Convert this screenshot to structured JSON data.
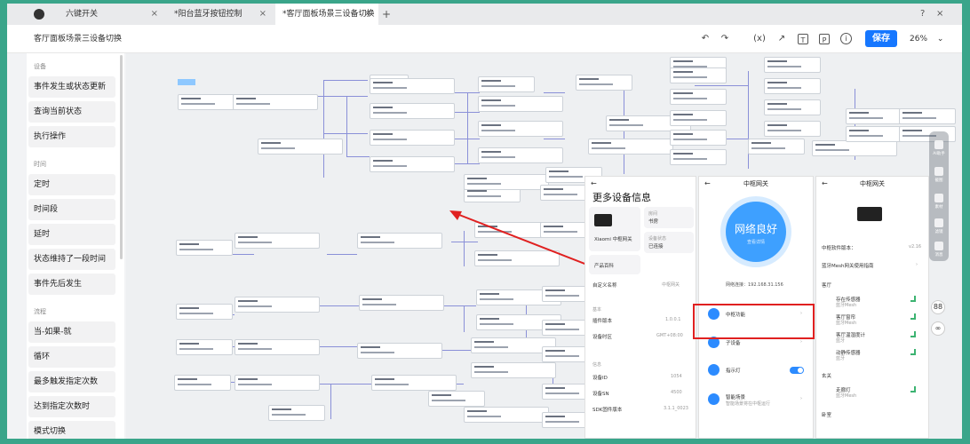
{
  "tabs": [
    {
      "label": "六键开关",
      "close": "×"
    },
    {
      "label": "*阳台蓝牙按钮控制",
      "close": "×"
    },
    {
      "label": "*客厅面板场景三设备切换",
      "close": "×"
    }
  ],
  "tab_plus": "+",
  "window_controls": {
    "help": "?",
    "close": "×"
  },
  "toolbar": {
    "doc_title": "客厅面板场景三设备切换",
    "undo": "↶",
    "redo": "↷",
    "variable": "(x)",
    "export": "↗",
    "text": "T",
    "p": "P",
    "info": "i",
    "save_label": "保存",
    "zoom": "26%",
    "zoom_caret": "⌄"
  },
  "sidebar": {
    "sections": [
      {
        "title": "设备",
        "items": [
          "事件发生或状态更新",
          "查询当前状态",
          "执行操作"
        ]
      },
      {
        "title": "时间",
        "items": [
          "定时",
          "时间段",
          "延时",
          "状态维持了一段时间",
          "事件先后发生"
        ]
      },
      {
        "title": "流程",
        "items": [
          "当-如果-就",
          "循环",
          "最多触发指定次数",
          "达到指定次数时",
          "模式切换"
        ]
      }
    ]
  },
  "panel1": {
    "back": "←",
    "title": "更多设备信息",
    "device_name": "Xiaomi 中枢网关",
    "location_label": "房间",
    "location_value": "书房",
    "product_label": "产品百科",
    "status_label": "设备状态",
    "status_value": "已连接",
    "custom_name": "自定义名称",
    "custom_name_value": "中枢网关",
    "section_basic": "基本",
    "plugin_version": "插件版本",
    "plugin_version_value": "1.0.0.1",
    "timezone": "设备时区",
    "timezone_value": "GMT+08:00",
    "section_info": "信息",
    "device_id": "设备ID",
    "device_id_value": "1054",
    "device_sn": "设备SN",
    "device_sn_value": "4500",
    "sdk_version": "SDK固件版本",
    "sdk_version_value": "3.1.1_0023"
  },
  "panel2": {
    "back": "←",
    "title": "中枢网关",
    "status_big": "网络良好",
    "status_sub": "查看详情",
    "ip": "网络连接：192.168.31.156",
    "rows": [
      {
        "label": "中枢功能",
        "chev": "›"
      },
      {
        "label": "子设备",
        "chev": "›"
      },
      {
        "label": "指示灯",
        "chev": ""
      },
      {
        "label": "智能场景",
        "sub": "智能场景将在中枢运行",
        "chev": "›"
      }
    ]
  },
  "panel3": {
    "back": "←",
    "title": "中枢网关",
    "fw_label": "中枢软件版本：",
    "fw_value": "v2.16",
    "guide": "蓝牙Mesh网关使用指南",
    "guide_chev": "›",
    "room1": "客厅",
    "devices": [
      {
        "name": "存在传感器",
        "sub": "蓝牙Mesh"
      },
      {
        "name": "客厅窗帘",
        "sub": "蓝牙Mesh"
      },
      {
        "name": "客厅温湿度计",
        "sub": "蓝牙"
      },
      {
        "name": "动静传感器",
        "sub": "蓝牙"
      }
    ],
    "room2": "玄关",
    "device5": {
      "name": "走廊灯",
      "sub": "蓝牙Mesh"
    },
    "room3": "卧室"
  },
  "right_toolbar": {
    "labels": [
      "AI助手",
      "截图",
      "素材",
      "滤镜",
      "消息"
    ],
    "grid": "88",
    "bot": "∞"
  },
  "colors": {
    "accent": "#1677ff",
    "edge": "#8a90d8",
    "highlight": "#e02020",
    "canvas": "#eef0f2"
  }
}
